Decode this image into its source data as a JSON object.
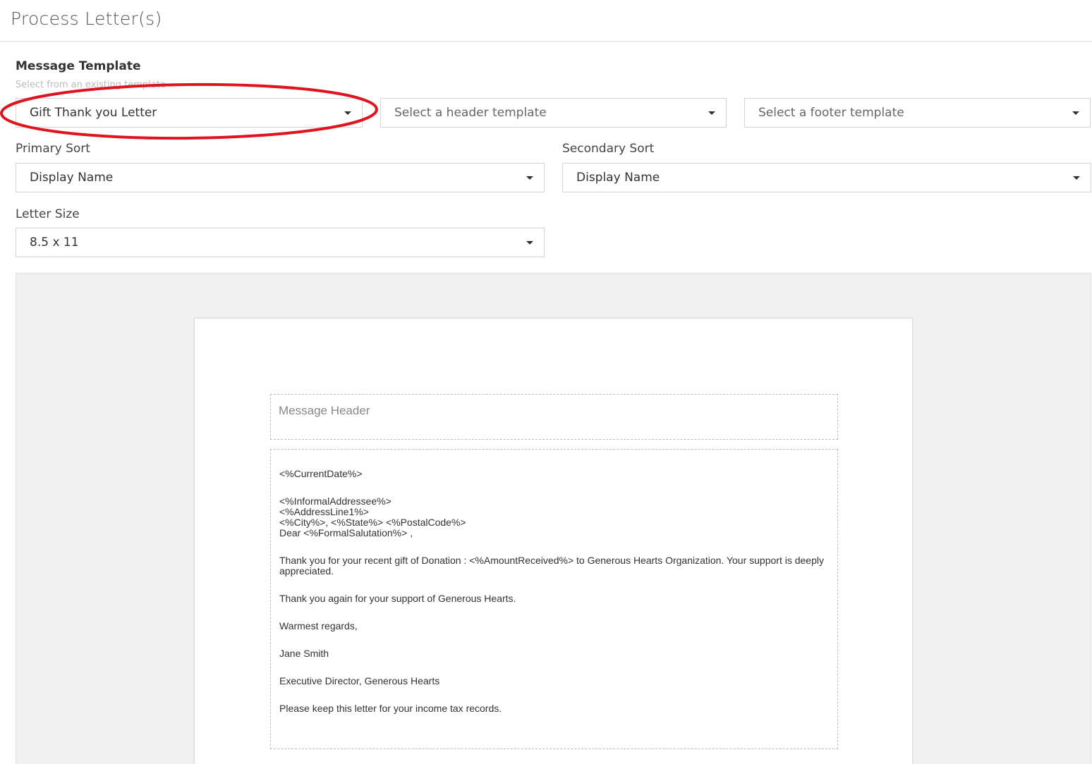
{
  "page": {
    "title": "Process Letter(s)"
  },
  "message_template": {
    "label": "Message Template",
    "helper": "Select from an existing template",
    "template_value": "Gift Thank you Letter",
    "header_placeholder": "Select a header template",
    "footer_placeholder": "Select a footer template"
  },
  "sorting": {
    "primary_label": "Primary Sort",
    "primary_value": "Display Name",
    "secondary_label": "Secondary Sort",
    "secondary_value": "Display Name"
  },
  "letter_size": {
    "label": "Letter Size",
    "value": "8.5 x 11"
  },
  "preview": {
    "header_text": "Message Header",
    "body": {
      "date": "<%CurrentDate%>",
      "address_1": "<%InformalAddressee%>",
      "address_2": "<%AddressLine1%>",
      "address_3": "<%City%>, <%State%> <%PostalCode%>",
      "salutation": "Dear <%FormalSalutation%> ,",
      "thanks": "Thank you for your recent gift of Donation : <%AmountReceived%>  to Generous Hearts Organization. Your support is deeply appreciated.",
      "thanks_again": "Thank you again for your support of Generous Hearts.",
      "closing": "Warmest regards,",
      "signer_name": "Jane Smith",
      "signer_title": "Executive Director, Generous Hearts",
      "note": "Please keep this letter for your income tax records."
    }
  },
  "colors": {
    "annotation": "#e0141e",
    "preview_background": "#f0f0f0",
    "border": "#d4d4d4"
  },
  "icons": {
    "dropdown": "caret-down-icon"
  }
}
